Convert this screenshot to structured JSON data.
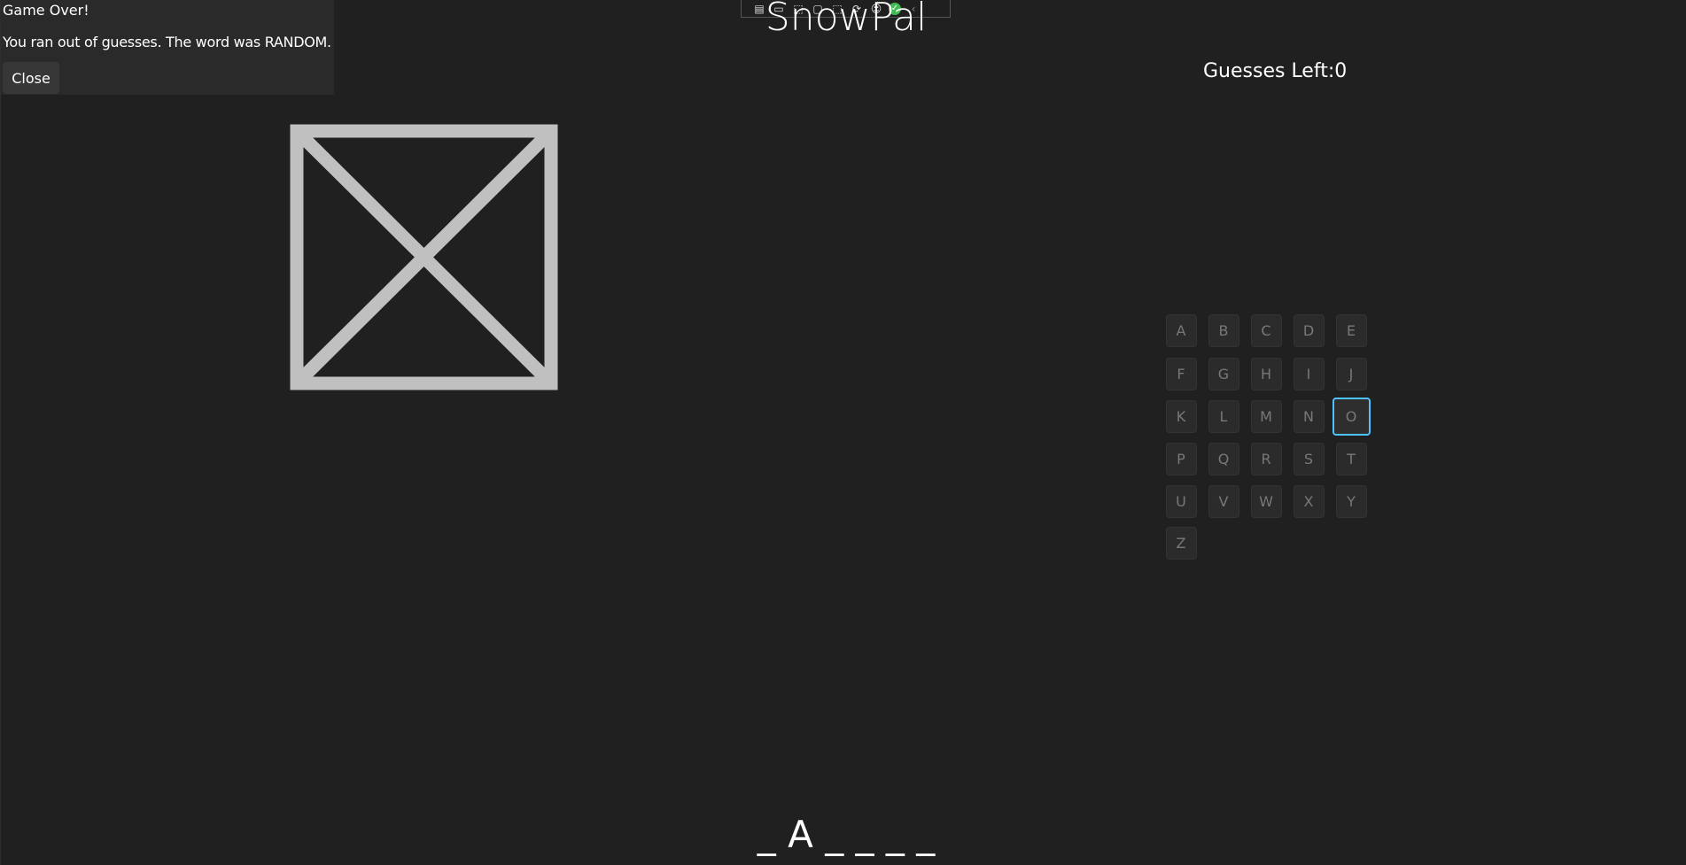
{
  "dialog": {
    "title": "Game Over!",
    "message": "You ran out of guesses. The word was RANDOM.",
    "close_label": "Close"
  },
  "toolbar": {
    "icons": [
      "live-visual-tree-icon",
      "video-icon",
      "select-element-icon",
      "display-layout-adorners-icon",
      "track-focus-icon",
      "hot-reload-icon",
      "accessibility-icon",
      "binding-check-icon",
      "collapse-chevron-icon"
    ]
  },
  "app": {
    "title": "SnowPal",
    "guesses_left": "Guesses Left:0",
    "word_display": "_ A _ _ _ _"
  },
  "keyboard": {
    "letters": [
      "A",
      "B",
      "C",
      "D",
      "E",
      "F",
      "G",
      "H",
      "I",
      "J",
      "K",
      "L",
      "M",
      "N",
      "O",
      "P",
      "Q",
      "R",
      "S",
      "T",
      "U",
      "V",
      "W",
      "X",
      "Y",
      "Z"
    ],
    "focused": "O"
  },
  "colors": {
    "background": "#202020",
    "focus_ring": "#4cc2ff",
    "placeholder_stroke": "#c0c0c0"
  }
}
